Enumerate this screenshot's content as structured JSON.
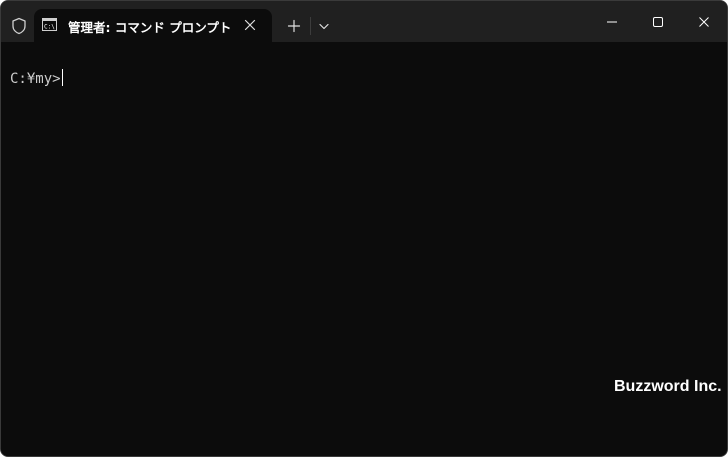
{
  "window": {
    "tab": {
      "title": "管理者: コマンド プロンプト",
      "icon": "cmd-icon",
      "close_icon": "close-icon"
    },
    "titlebar_icons": {
      "shield": "shield-icon",
      "new_tab": "plus-icon",
      "dropdown": "chevron-down-icon",
      "minimize": "minimize-icon",
      "maximize": "maximize-icon",
      "close": "close-icon"
    }
  },
  "terminal": {
    "prompt": "C:¥my>"
  },
  "watermark": "Buzzword Inc.",
  "colors": {
    "titlebar_bg": "#202020",
    "terminal_bg": "#0c0c0c",
    "text": "#cccccc",
    "tab_title": "#ffffff"
  }
}
